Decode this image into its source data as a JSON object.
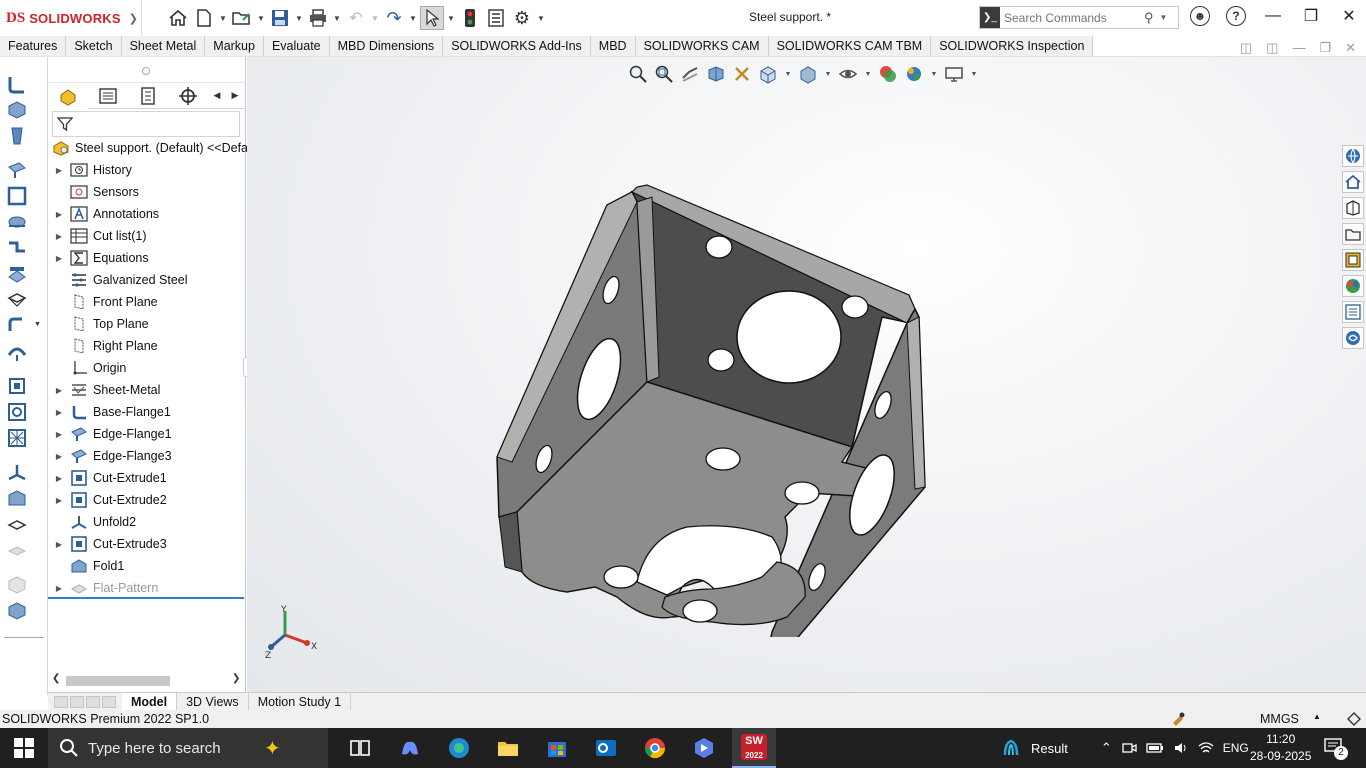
{
  "app": {
    "brand_prefix": "DS",
    "brand_name": "SOLIDWORKS",
    "document_title": "Steel support. *"
  },
  "search": {
    "placeholder": "Search Commands"
  },
  "command_tabs": [
    "Features",
    "Sketch",
    "Sheet Metal",
    "Markup",
    "Evaluate",
    "MBD Dimensions",
    "SOLIDWORKS Add-Ins",
    "MBD",
    "SOLIDWORKS CAM",
    "SOLIDWORKS CAM TBM",
    "SOLIDWORKS Inspection"
  ],
  "feature_tree": {
    "root": "Steel support. (Default) <<Defau",
    "items": [
      {
        "label": "History",
        "expandable": true,
        "icon": "history-icon"
      },
      {
        "label": "Sensors",
        "expandable": false,
        "icon": "sensors-icon"
      },
      {
        "label": "Annotations",
        "expandable": true,
        "icon": "annotations-icon"
      },
      {
        "label": "Cut list(1)",
        "expandable": true,
        "icon": "cut-list-icon"
      },
      {
        "label": "Equations",
        "expandable": true,
        "icon": "equations-icon"
      },
      {
        "label": "Galvanized Steel",
        "expandable": false,
        "icon": "material-icon"
      },
      {
        "label": "Front Plane",
        "expandable": false,
        "icon": "plane-icon"
      },
      {
        "label": "Top Plane",
        "expandable": false,
        "icon": "plane-icon"
      },
      {
        "label": "Right Plane",
        "expandable": false,
        "icon": "plane-icon"
      },
      {
        "label": "Origin",
        "expandable": false,
        "icon": "origin-icon"
      },
      {
        "label": "Sheet-Metal",
        "expandable": true,
        "icon": "sheet-metal-icon"
      },
      {
        "label": "Base-Flange1",
        "expandable": true,
        "icon": "base-flange-icon"
      },
      {
        "label": "Edge-Flange1",
        "expandable": true,
        "icon": "edge-flange-icon"
      },
      {
        "label": "Edge-Flange3",
        "expandable": true,
        "icon": "edge-flange-icon"
      },
      {
        "label": "Cut-Extrude1",
        "expandable": true,
        "icon": "cut-extrude-icon"
      },
      {
        "label": "Cut-Extrude2",
        "expandable": true,
        "icon": "cut-extrude-icon"
      },
      {
        "label": "Unfold2",
        "expandable": false,
        "icon": "unfold-icon"
      },
      {
        "label": "Cut-Extrude3",
        "expandable": true,
        "icon": "cut-extrude-icon"
      },
      {
        "label": "Fold1",
        "expandable": false,
        "icon": "fold-icon"
      },
      {
        "label": "Flat-Pattern",
        "expandable": true,
        "icon": "flat-pattern-icon",
        "suppressed": true
      }
    ]
  },
  "triad": {
    "x": "X",
    "y": "Y",
    "z": "Z"
  },
  "bottom_tabs": [
    "Model",
    "3D Views",
    "Motion Study 1"
  ],
  "status": {
    "version": "SOLIDWORKS Premium 2022 SP1.0",
    "units": "MMGS"
  },
  "taskbar": {
    "search_placeholder": "Type here to search",
    "sw_badge": "2022",
    "weather": "Result",
    "language": "ENG",
    "time": "11:20",
    "date": "28-09-2025",
    "notifications": "2"
  },
  "colors": {
    "accent": "#2f7fd1",
    "brand": "#d3222a",
    "part": "#8e8e8c",
    "part_dark": "#555553"
  }
}
